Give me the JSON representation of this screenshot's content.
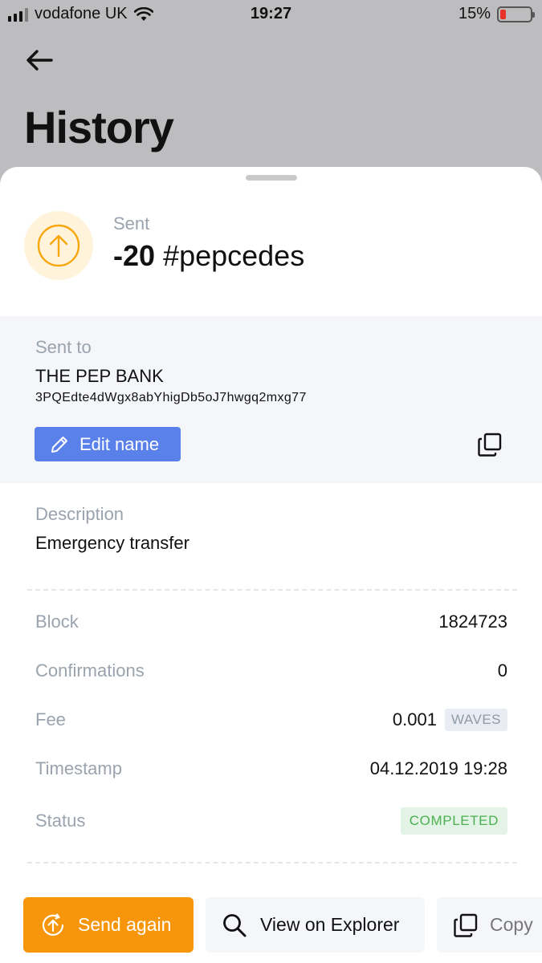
{
  "status_bar": {
    "carrier": "vodafone UK",
    "time": "19:27",
    "battery": "15%",
    "battery_level": 0.15
  },
  "header": {
    "title": "History"
  },
  "transaction": {
    "type": "Sent",
    "amount": "-20",
    "asset": "#pepcedes",
    "icon": "arrow-up-circle-icon",
    "icon_color": "#f7a60b"
  },
  "recipient": {
    "label": "Sent to",
    "name": "THE PEP BANK",
    "address": "3PQEdte4dWgx8abYhigDb5oJ7hwgq2mxg77",
    "edit_label": "Edit name",
    "accent": "#5a81ea"
  },
  "description": {
    "label": "Description",
    "value": "Emergency transfer"
  },
  "details": [
    {
      "label": "Block",
      "value": "1824723"
    },
    {
      "label": "Confirmations",
      "value": "0"
    },
    {
      "label": "Fee",
      "value": "0.001",
      "unit": "WAVES"
    },
    {
      "label": "Timestamp",
      "value": "04.12.2019 19:28"
    },
    {
      "label": "Status",
      "value": "COMPLETED"
    }
  ],
  "actions": {
    "send_again": "Send again",
    "view_explorer": "View on Explorer",
    "copy": "Copy",
    "send_again_color": "#f7960b"
  }
}
